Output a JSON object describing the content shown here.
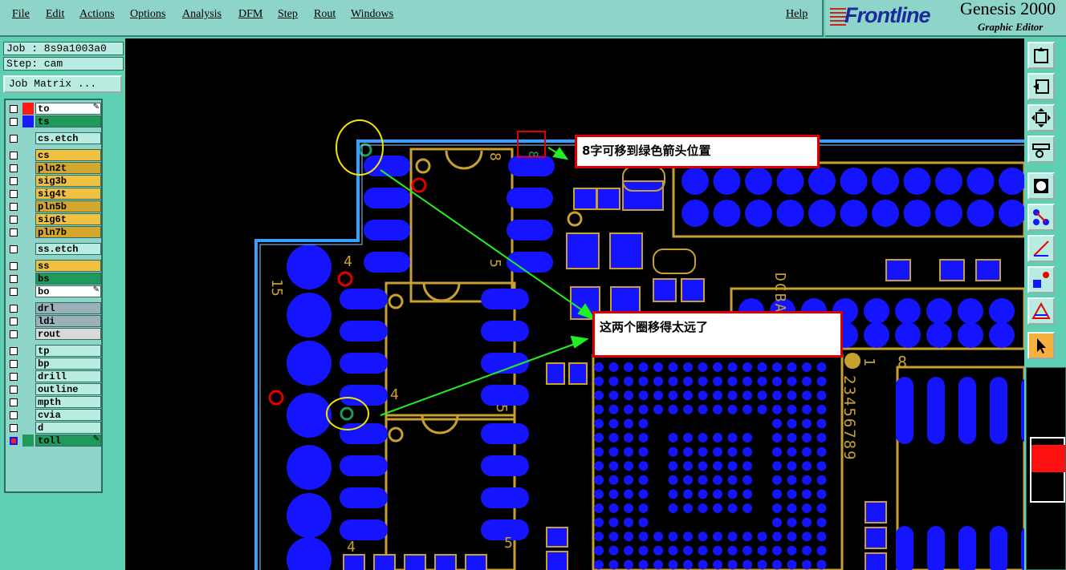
{
  "menubar": {
    "items": [
      "File",
      "Edit",
      "Actions",
      "Options",
      "Analysis",
      "DFM",
      "Step",
      "Rout",
      "Windows"
    ],
    "help": "Help"
  },
  "logo": {
    "brand": "Frontline",
    "product": "Genesis 2000",
    "subtitle": "Graphic Editor"
  },
  "job": {
    "job_label": "Job : 8s9a1003a0",
    "step_label": "Step: cam",
    "matrix_button": "Job Matrix ..."
  },
  "layers": [
    {
      "name": "to",
      "color": "#ff1a1a",
      "bg": "#ffffff",
      "edit": true
    },
    {
      "name": "ts",
      "color": "#1a1aff",
      "bg": "#1f9a5a"
    },
    {
      "name": "cs.etch",
      "color": "",
      "bg": "#b8ece0"
    },
    {
      "name": "cs",
      "color": "",
      "bg": "#f0c040"
    },
    {
      "name": "pln2t",
      "color": "",
      "bg": "#d4a72c"
    },
    {
      "name": "sig3b",
      "color": "",
      "bg": "#f0c040"
    },
    {
      "name": "sig4t",
      "color": "",
      "bg": "#f0c040"
    },
    {
      "name": "pln5b",
      "color": "",
      "bg": "#d4a72c"
    },
    {
      "name": "sig6t",
      "color": "",
      "bg": "#f0c040"
    },
    {
      "name": "pln7b",
      "color": "",
      "bg": "#d4a72c"
    },
    {
      "name": "ss.etch",
      "color": "",
      "bg": "#b8ece0"
    },
    {
      "name": "ss",
      "color": "",
      "bg": "#f0c040"
    },
    {
      "name": "bs",
      "color": "",
      "bg": "#1f9a5a"
    },
    {
      "name": "bo",
      "color": "",
      "bg": "#ffffff",
      "edit": true
    },
    {
      "name": "drl",
      "color": "",
      "bg": "#9bb0b8"
    },
    {
      "name": "ldi",
      "color": "",
      "bg": "#9bb0b8"
    },
    {
      "name": "rout",
      "color": "",
      "bg": "#d9d9d9"
    },
    {
      "name": "tp",
      "color": "",
      "bg": "#b8ece0"
    },
    {
      "name": "bp",
      "color": "",
      "bg": "#b8ece0"
    },
    {
      "name": "drill",
      "color": "",
      "bg": "#b8ece0"
    },
    {
      "name": "outline",
      "color": "",
      "bg": "#b8ece0"
    },
    {
      "name": "mpth",
      "color": "",
      "bg": "#b8ece0"
    },
    {
      "name": "cvia",
      "color": "",
      "bg": "#b8ece0"
    },
    {
      "name": "d",
      "color": "",
      "bg": "#b8ece0"
    },
    {
      "name": "toll",
      "color": "#1f9a5a",
      "bg": "#1f9a5a",
      "edit": true
    }
  ],
  "annotations": {
    "note1": "8字可移到绿色箭头位置",
    "note2": "这两个圈移得太远了"
  },
  "board_labels": {
    "l15": "15",
    "l4a": "4",
    "l4b": "4",
    "l4c": "4",
    "l8a": "8",
    "l8b": "8",
    "l8c": "8",
    "l5a": "5",
    "l5b": "5",
    "l5c": "5",
    "l1": "1",
    "dcba": "DCBA",
    "digits": "23456789"
  },
  "colors": {
    "pad": "#1414ff",
    "outline": "#c8a030",
    "arrow": "#22ee22",
    "circle": "#f2e600",
    "mark": "#e00000",
    "board_edge": "#3aa0ff"
  }
}
